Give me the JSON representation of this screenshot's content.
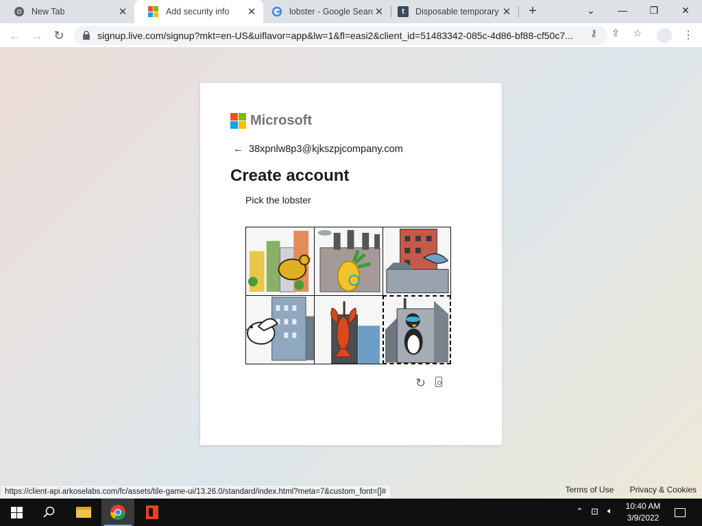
{
  "browser": {
    "tabs": [
      {
        "title": "New Tab",
        "icon": "chrome-icon"
      },
      {
        "title": "Add security info",
        "icon": "microsoft-icon",
        "active": true
      },
      {
        "title": "lobster - Google Search",
        "icon": "google-icon"
      },
      {
        "title": "Disposable temporary",
        "icon": "temp-mail-icon"
      }
    ],
    "url": "signup.live.com/signup?mkt=en-US&uiflavor=app&lw=1&fl=easi2&client_id=51483342-085c-4d86-bf88-cf50c7...",
    "status_url": "https://client-api.arkoselabs.com/fc/assets/tile-game-ui/13.26.0/standard/index.html?meta=7&custom_font=[]#"
  },
  "card": {
    "brand": "Microsoft",
    "identity": "38xpnlw8p3@kjkszpjcompany.com",
    "title": "Create account",
    "prompt": "Pick the lobster",
    "tiles": [
      {
        "name": "chicken",
        "selected": false
      },
      {
        "name": "pineapple",
        "selected": false
      },
      {
        "name": "dolphin",
        "selected": false
      },
      {
        "name": "bird",
        "selected": false
      },
      {
        "name": "lobster",
        "selected": false
      },
      {
        "name": "penguin",
        "selected": true
      }
    ]
  },
  "footer": {
    "terms": "Terms of Use",
    "privacy": "Privacy & Cookies"
  },
  "taskbar": {
    "time": "10:40 AM",
    "date": "3/9/2022"
  },
  "colors": {
    "ms_red": "#f25022",
    "ms_green": "#7fba00",
    "ms_blue": "#00a4ef",
    "ms_yellow": "#ffb900"
  }
}
